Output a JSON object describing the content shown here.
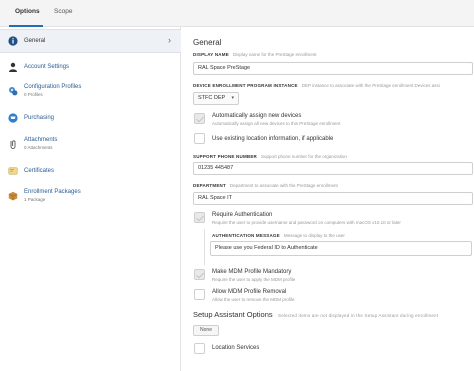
{
  "tabs": [
    {
      "label": "Options"
    },
    {
      "label": "Scope"
    }
  ],
  "sidebar": {
    "items": [
      {
        "label": "General",
        "sub": ""
      },
      {
        "label": "Account Settings",
        "sub": ""
      },
      {
        "label": "Configuration Profiles",
        "sub": "0 Profiles"
      },
      {
        "label": "Purchasing",
        "sub": ""
      },
      {
        "label": "Attachments",
        "sub": "0 Attachments"
      },
      {
        "label": "Certificates",
        "sub": ""
      },
      {
        "label": "Enrollment Packages",
        "sub": "1 Package"
      }
    ]
  },
  "main": {
    "title": "General",
    "display_name": {
      "label": "Display Name",
      "desc": "Display name for the PreStage enrollment",
      "value": "RAL Space PreStage"
    },
    "dep_instance": {
      "label": "Device Enrollment Program Instance",
      "desc": "DEP instance to associate with the PreStage enrollment Devices assi",
      "value": "STFC DEP"
    },
    "auto_assign": {
      "label": "Automatically assign new devices",
      "desc": "Automatically assign all new devices to this PreStage enrollment"
    },
    "existing_location": {
      "label": "Use existing location information, if applicable"
    },
    "support_phone": {
      "label": "Support Phone Number",
      "desc": "Support phone number for the organization",
      "value": "01235 445487"
    },
    "department": {
      "label": "Department",
      "desc": "Department to associate with the PreStage enrollment",
      "value": "RAL Space IT"
    },
    "require_auth": {
      "label": "Require Authentication",
      "desc": "Require the user to provide username and password on computers with macOS v10.10 or later"
    },
    "auth_message": {
      "label": "Authentication Message",
      "desc": "Message to display to the user",
      "value": "Please use you Federal ID to Authenticate"
    },
    "mdm_mandatory": {
      "label": "Make MDM Profile Mandatory",
      "desc": "Require the user to apply the MDM profile"
    },
    "mdm_removal": {
      "label": "Allow MDM Profile Removal",
      "desc": "Allow the user to remove the MDM profile"
    },
    "setup_assistant": {
      "title": "Setup Assistant Options",
      "desc": "Selected items are not displayed in the Setup Assistant during enrollment",
      "none_label": "None",
      "location_services": "Location Services"
    }
  },
  "colors": {
    "accent": "#1f6fb8",
    "link": "#2b5d93"
  }
}
